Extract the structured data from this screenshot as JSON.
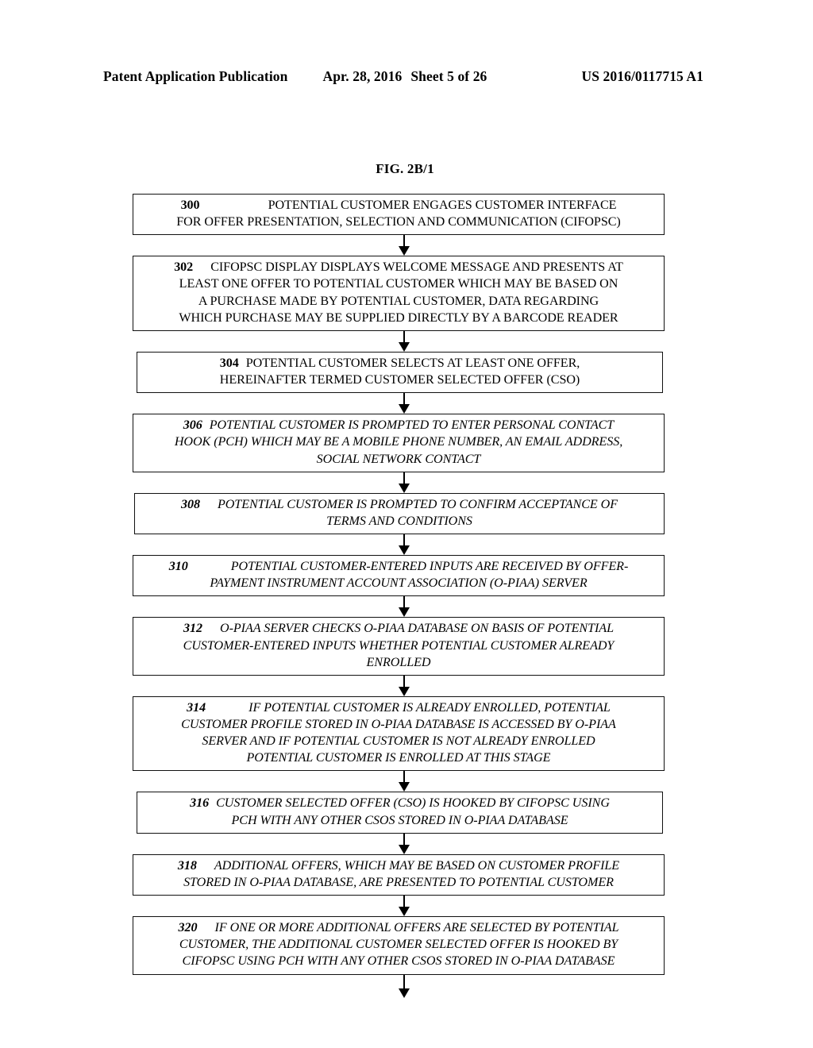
{
  "header": {
    "publication": "Patent Application Publication",
    "date": "Apr. 28, 2016",
    "sheet": "Sheet 5 of 26",
    "patent_number": "US 2016/0117715 A1"
  },
  "figure": {
    "label": "FIG. 2B/1"
  },
  "flowchart": {
    "type": "flowchart",
    "orientation": "vertical",
    "continues_to_next_sheet": true,
    "nodes": [
      {
        "id": "300",
        "style": "normal",
        "lines": [
          "POTENTIAL CUSTOMER ENGAGES CUSTOMER INTERFACE",
          "FOR OFFER PRESENTATION, SELECTION AND COMMUNICATION (CIFOPSC)"
        ],
        "text": "300 POTENTIAL CUSTOMER ENGAGES CUSTOMER INTERFACE FOR OFFER PRESENTATION, SELECTION AND COMMUNICATION (CIFOPSC)"
      },
      {
        "id": "302",
        "style": "normal",
        "lines": [
          "CIFOPSC DISPLAY DISPLAYS WELCOME MESSAGE AND PRESENTS AT",
          "LEAST ONE OFFER TO POTENTIAL CUSTOMER WHICH MAY BE BASED ON",
          "A PURCHASE MADE BY POTENTIAL CUSTOMER, DATA REGARDING",
          "WHICH PURCHASE MAY BE SUPPLIED DIRECTLY BY A BARCODE READER"
        ],
        "text": "302 CIFOPSC DISPLAY DISPLAYS WELCOME MESSAGE AND PRESENTS AT LEAST ONE OFFER TO POTENTIAL CUSTOMER WHICH MAY BE BASED ON A PURCHASE MADE BY POTENTIAL CUSTOMER, DATA REGARDING WHICH PURCHASE MAY BE SUPPLIED DIRECTLY BY A BARCODE READER"
      },
      {
        "id": "304",
        "style": "normal",
        "lines": [
          "POTENTIAL CUSTOMER SELECTS AT LEAST ONE OFFER,",
          "HEREINAFTER TERMED CUSTOMER SELECTED OFFER (CSO)"
        ],
        "text": "304 POTENTIAL CUSTOMER SELECTS AT LEAST ONE OFFER, HEREINAFTER TERMED CUSTOMER SELECTED OFFER (CSO)"
      },
      {
        "id": "306",
        "style": "italic",
        "lines": [
          "POTENTIAL CUSTOMER IS PROMPTED TO ENTER PERSONAL CONTACT",
          "HOOK (PCH) WHICH MAY BE A MOBILE PHONE NUMBER, AN EMAIL ADDRESS,",
          "SOCIAL NETWORK CONTACT"
        ],
        "text": "306 POTENTIAL CUSTOMER IS PROMPTED TO ENTER PERSONAL CONTACT HOOK (PCH) WHICH MAY BE A MOBILE PHONE NUMBER, AN EMAIL ADDRESS, SOCIAL NETWORK CONTACT"
      },
      {
        "id": "308",
        "style": "italic",
        "lines": [
          "POTENTIAL CUSTOMER IS PROMPTED TO CONFIRM ACCEPTANCE OF",
          "TERMS AND CONDITIONS"
        ],
        "text": "308 POTENTIAL CUSTOMER IS PROMPTED TO CONFIRM ACCEPTANCE OF TERMS AND CONDITIONS"
      },
      {
        "id": "310",
        "style": "italic",
        "lines": [
          "POTENTIAL CUSTOMER-ENTERED INPUTS ARE RECEIVED BY OFFER-",
          "PAYMENT INSTRUMENT ACCOUNT ASSOCIATION (O-PIAA) SERVER"
        ],
        "text": "310 POTENTIAL CUSTOMER-ENTERED INPUTS ARE RECEIVED BY OFFER-PAYMENT INSTRUMENT ACCOUNT ASSOCIATION (O-PIAA) SERVER"
      },
      {
        "id": "312",
        "style": "italic",
        "lines": [
          "O-PIAA SERVER CHECKS O-PIAA DATABASE ON BASIS OF POTENTIAL",
          "CUSTOMER-ENTERED INPUTS WHETHER POTENTIAL CUSTOMER ALREADY",
          "ENROLLED"
        ],
        "text": "312 O-PIAA SERVER CHECKS O-PIAA DATABASE ON BASIS OF POTENTIAL CUSTOMER-ENTERED INPUTS WHETHER POTENTIAL CUSTOMER ALREADY ENROLLED"
      },
      {
        "id": "314",
        "style": "italic",
        "lines": [
          "IF POTENTIAL CUSTOMER IS ALREADY ENROLLED, POTENTIAL",
          "CUSTOMER PROFILE STORED IN O-PIAA DATABASE IS ACCESSED BY O-PIAA",
          "SERVER AND IF POTENTIAL CUSTOMER IS NOT ALREADY ENROLLED",
          "POTENTIAL CUSTOMER IS ENROLLED AT THIS STAGE"
        ],
        "text": "314 IF POTENTIAL CUSTOMER IS ALREADY ENROLLED, POTENTIAL CUSTOMER PROFILE STORED IN O-PIAA DATABASE IS ACCESSED BY O-PIAA SERVER AND IF POTENTIAL CUSTOMER IS NOT ALREADY ENROLLED POTENTIAL CUSTOMER IS ENROLLED AT THIS STAGE"
      },
      {
        "id": "316",
        "style": "italic",
        "lines": [
          "CUSTOMER SELECTED OFFER (CSO) IS HOOKED BY CIFOPSC USING",
          "PCH WITH ANY OTHER CSOS STORED IN O-PIAA DATABASE"
        ],
        "text": "316 CUSTOMER SELECTED OFFER (CSO) IS HOOKED BY CIFOPSC USING PCH WITH ANY OTHER CSOS STORED IN O-PIAA DATABASE"
      },
      {
        "id": "318",
        "style": "italic",
        "lines": [
          "ADDITIONAL OFFERS, WHICH MAY BE BASED ON CUSTOMER PROFILE",
          "STORED IN O-PIAA DATABASE, ARE PRESENTED TO POTENTIAL CUSTOMER"
        ],
        "text": "318 ADDITIONAL OFFERS, WHICH MAY BE BASED ON CUSTOMER PROFILE STORED IN O-PIAA DATABASE, ARE PRESENTED TO POTENTIAL CUSTOMER"
      },
      {
        "id": "320",
        "style": "italic",
        "lines": [
          "IF ONE OR MORE ADDITIONAL OFFERS ARE SELECTED BY POTENTIAL",
          "CUSTOMER, THE ADDITIONAL CUSTOMER SELECTED OFFER IS HOOKED BY",
          "CIFOPSC USING PCH WITH ANY OTHER CSOS STORED IN O-PIAA DATABASE"
        ],
        "text": "320 IF ONE OR MORE ADDITIONAL OFFERS ARE SELECTED BY POTENTIAL CUSTOMER, THE ADDITIONAL CUSTOMER SELECTED OFFER IS HOOKED BY CIFOPSC USING PCH WITH ANY OTHER CSOS STORED IN O-PIAA DATABASE"
      }
    ]
  }
}
